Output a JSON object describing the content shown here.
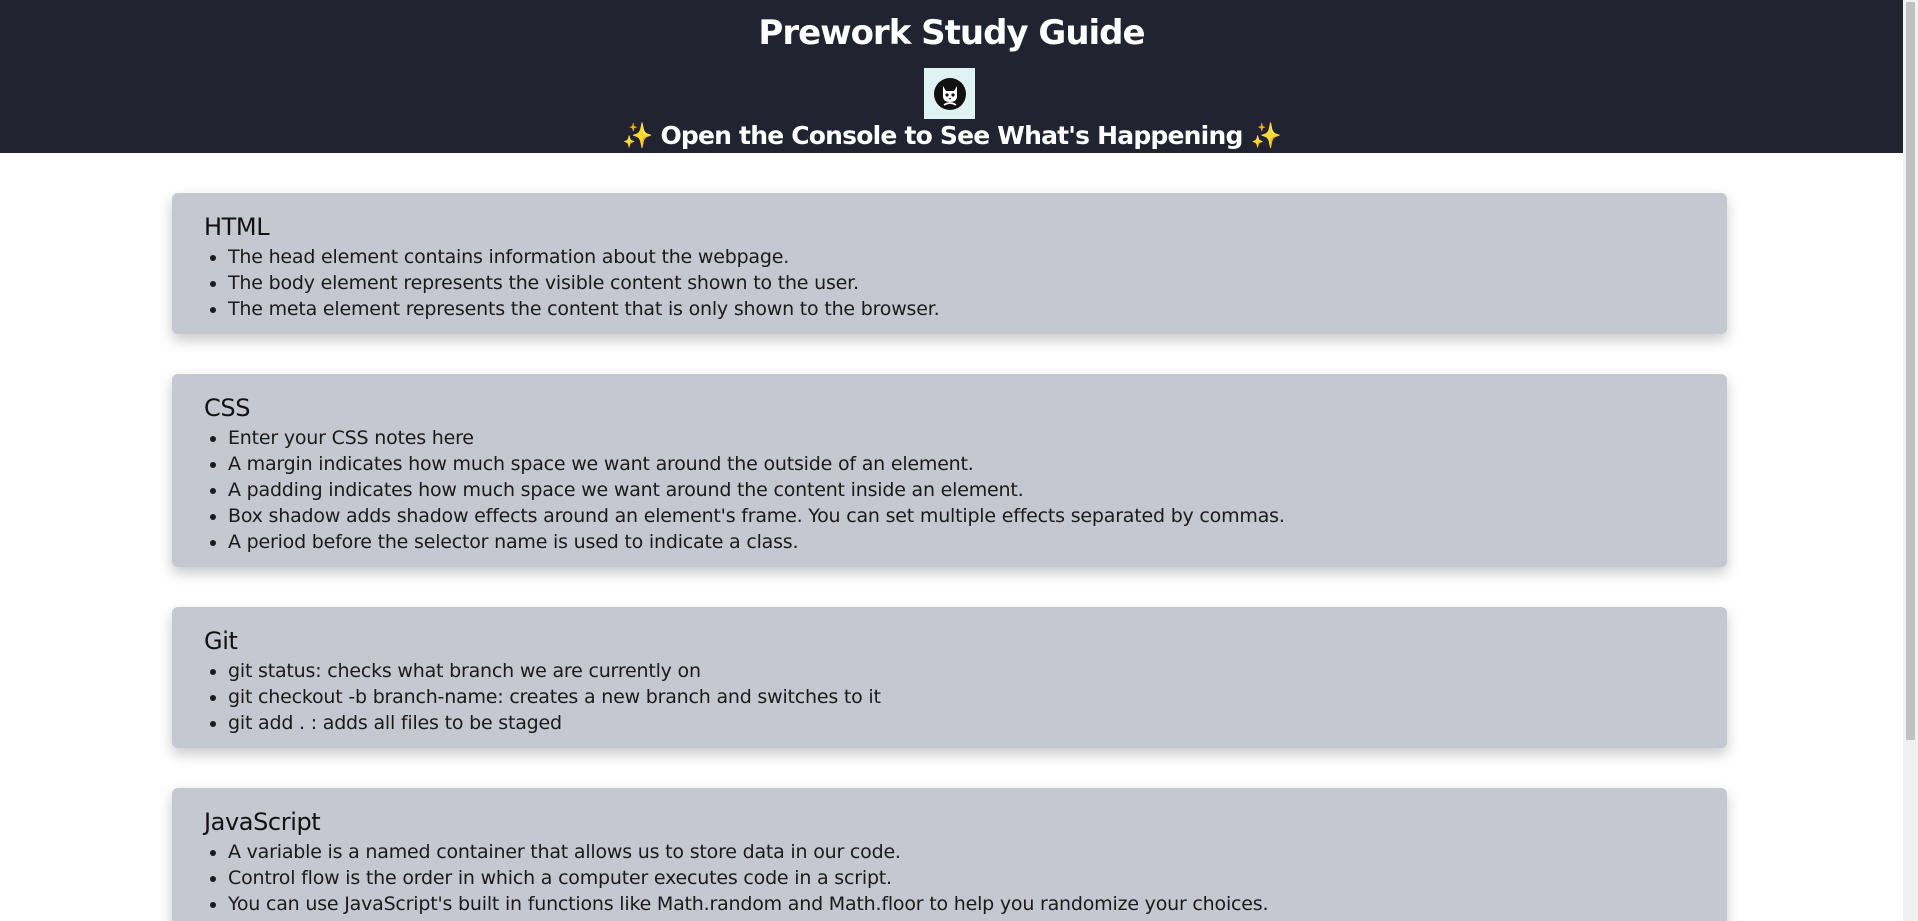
{
  "header": {
    "title": "Prework Study Guide",
    "logo_icon": "cat-logo-icon",
    "subtitle_sparkle_left": "✨",
    "subtitle": "Open the Console to See What's Happening",
    "subtitle_sparkle_right": "✨"
  },
  "sections": [
    {
      "title": "HTML",
      "items": [
        "The head element contains information about the webpage.",
        "The body element represents the visible content shown to the user.",
        "The meta element represents the content that is only shown to the browser."
      ]
    },
    {
      "title": "CSS",
      "items": [
        "Enter your CSS notes here",
        "A margin indicates how much space we want around the outside of an element.",
        "A padding indicates how much space we want around the content inside an element.",
        "Box shadow adds shadow effects around an element's frame. You can set multiple effects separated by commas.",
        "A period before the selector name is used to indicate a class."
      ]
    },
    {
      "title": "Git",
      "items": [
        "git status: checks what branch we are currently on",
        "git checkout -b branch-name: creates a new branch and switches to it",
        "git add . : adds all files to be staged"
      ]
    },
    {
      "title": "JavaScript",
      "items": [
        "A variable is a named container that allows us to store data in our code.",
        "Control flow is the order in which a computer executes code in a script.",
        "You can use JavaScript's built in functions like Math.random and Math.floor to help you randomize your choices."
      ]
    }
  ],
  "colors": {
    "header_bg": "#212330",
    "card_bg": "#c5c7d1",
    "page_bg": "#ffffff"
  }
}
